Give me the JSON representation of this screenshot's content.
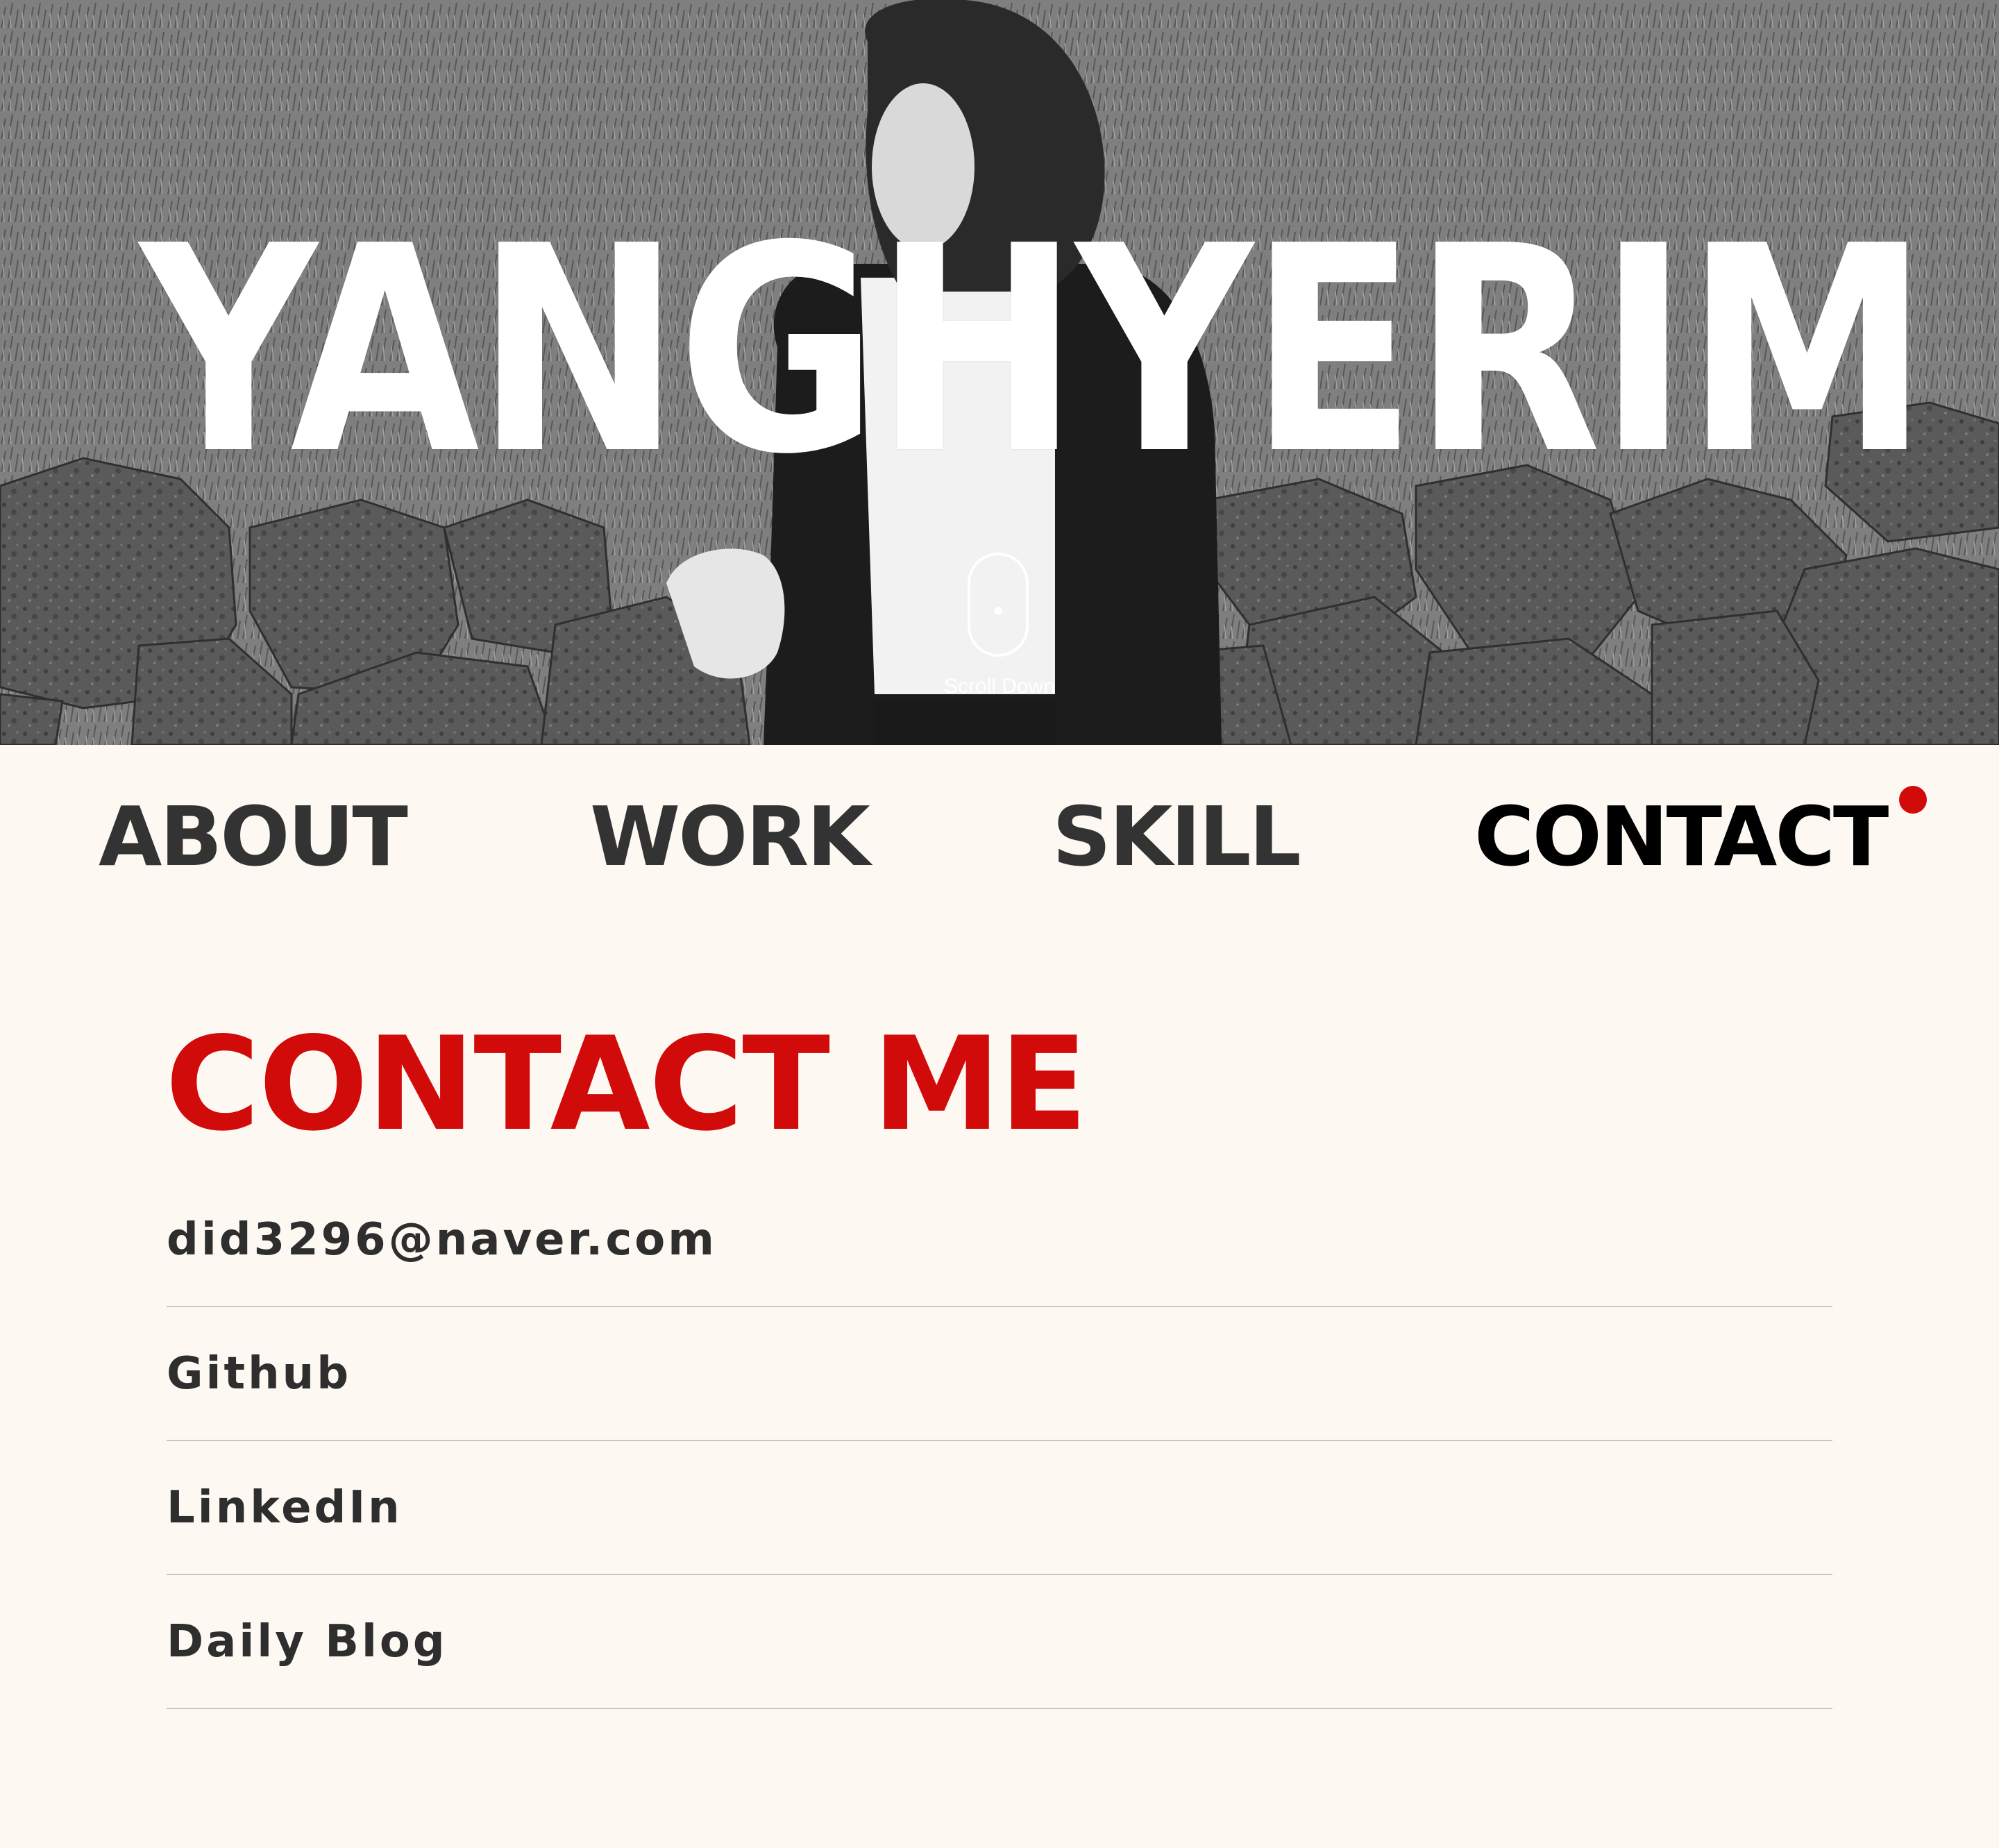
{
  "hero": {
    "title": "YANGHYERIM",
    "scroll_label": "Scroll Down"
  },
  "nav": {
    "items": [
      {
        "label": "ABOUT",
        "active": false
      },
      {
        "label": "WORK",
        "active": false
      },
      {
        "label": "SKILL",
        "active": false
      },
      {
        "label": "CONTACT",
        "active": true
      }
    ]
  },
  "contact": {
    "heading": "CONTACT ME",
    "links": [
      {
        "label": "did3296@naver.com"
      },
      {
        "label": "Github"
      },
      {
        "label": "LinkedIn"
      },
      {
        "label": "Daily Blog"
      }
    ]
  },
  "colors": {
    "background": "#fdf8f2",
    "accent": "#d10a0a",
    "text": "#333333",
    "divider": "#c9c6c1"
  }
}
